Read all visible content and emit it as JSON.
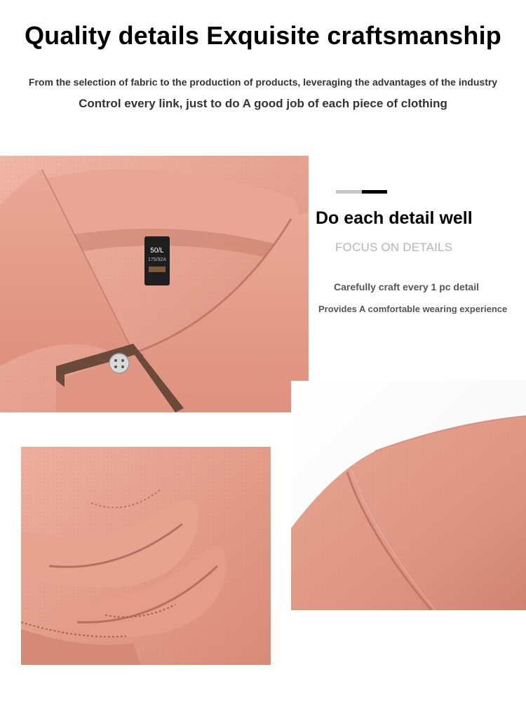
{
  "header": {
    "title": "Quality details Exquisite craftsmanship",
    "subtitle_1": "From the selection of fabric to the production of products, leveraging the advantages of the industry",
    "subtitle_2": "Control every link, just to do A good job of each piece of clothing"
  },
  "detail": {
    "title": "Do each detail well",
    "subtitle": "FOCUS ON DETAILS",
    "line_1": "Carefully craft every 1 pc detail",
    "line_2": "Provides A comfortable wearing experience"
  },
  "label_tag": {
    "size": "50/L",
    "code": "175/92A"
  },
  "colors": {
    "fabric": "#e5a08e",
    "fabric_shadow": "#c97c69",
    "fabric_highlight": "#f0b6a6",
    "trim": "#6b4a3a",
    "accent_grey": "#c8c8c8",
    "accent_black": "#000000"
  }
}
